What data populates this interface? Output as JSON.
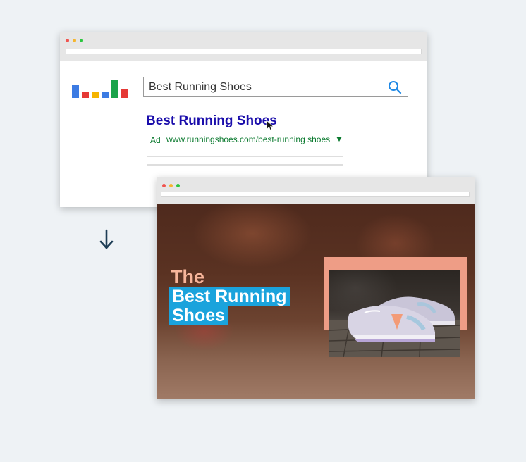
{
  "search_window": {
    "chrome": {
      "dots": [
        "#f0544f",
        "#f5b52e",
        "#2cc640"
      ]
    },
    "logo": {
      "name": "search-engine-logo",
      "bar_colors": [
        "#3c7be3",
        "#e53935",
        "#f5b400",
        "#3c7be3",
        "#1aa34a",
        "#e53935"
      ]
    },
    "search": {
      "query": "Best Running Shoes",
      "icon": "search-icon"
    },
    "result": {
      "title": "Best Running Shoes",
      "ad_label": "Ad",
      "url": "www.runningshoes.com/best-running shoes"
    }
  },
  "arrow": {
    "icon": "arrow-down-icon"
  },
  "landing_window": {
    "chrome": {
      "dots": [
        "#f0544f",
        "#f5b52e",
        "#2cc640"
      ]
    },
    "hero": {
      "heading_line1": "The",
      "heading_line2": "Best Running",
      "heading_line3": "Shoes",
      "highlight_color": "#1aa3dc",
      "accent_color": "#f7b59a",
      "image": "running-shoe-photo"
    }
  }
}
